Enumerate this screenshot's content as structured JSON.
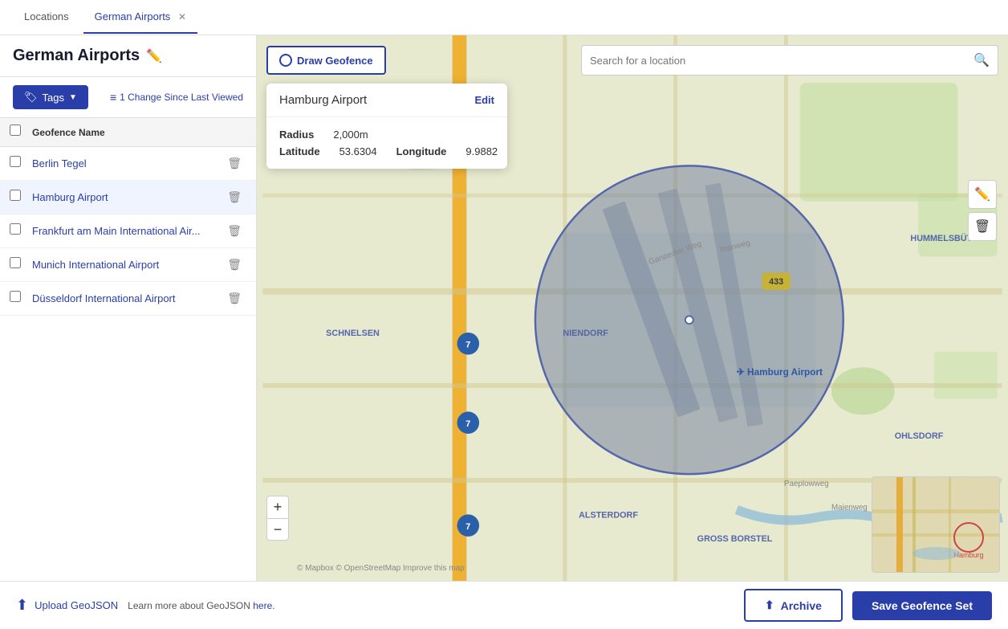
{
  "tabs": [
    {
      "label": "Locations",
      "active": false
    },
    {
      "label": "German Airports",
      "active": true,
      "closable": true
    }
  ],
  "sidebar": {
    "title": "German Airports",
    "table_header": "Geofence Name",
    "geofences": [
      {
        "name": "Berlin Tegel",
        "selected": false
      },
      {
        "name": "Hamburg Airport",
        "selected": true
      },
      {
        "name": "Frankfurt am Main International Air...",
        "selected": false
      },
      {
        "name": "Munich International Airport",
        "selected": false
      },
      {
        "name": "Düsseldorf International Airport",
        "selected": false
      }
    ]
  },
  "toolbar": {
    "tags_label": "Tags",
    "changes_label": "1 Change Since Last Viewed"
  },
  "map": {
    "draw_btn": "Draw Geofence",
    "search_placeholder": "Search for a location",
    "popup": {
      "title": "Hamburg Airport",
      "edit_label": "Edit",
      "radius_label": "Radius",
      "radius_value": "2,000m",
      "latitude_label": "Latitude",
      "latitude_value": "53.6304",
      "longitude_label": "Longitude",
      "longitude_value": "9.9882"
    }
  },
  "bottom": {
    "upload_label": "Upload GeoJSON",
    "info_text": "Learn more about GeoJSON",
    "info_link": "here.",
    "archive_label": "Archive",
    "save_label": "Save Geofence Set"
  }
}
